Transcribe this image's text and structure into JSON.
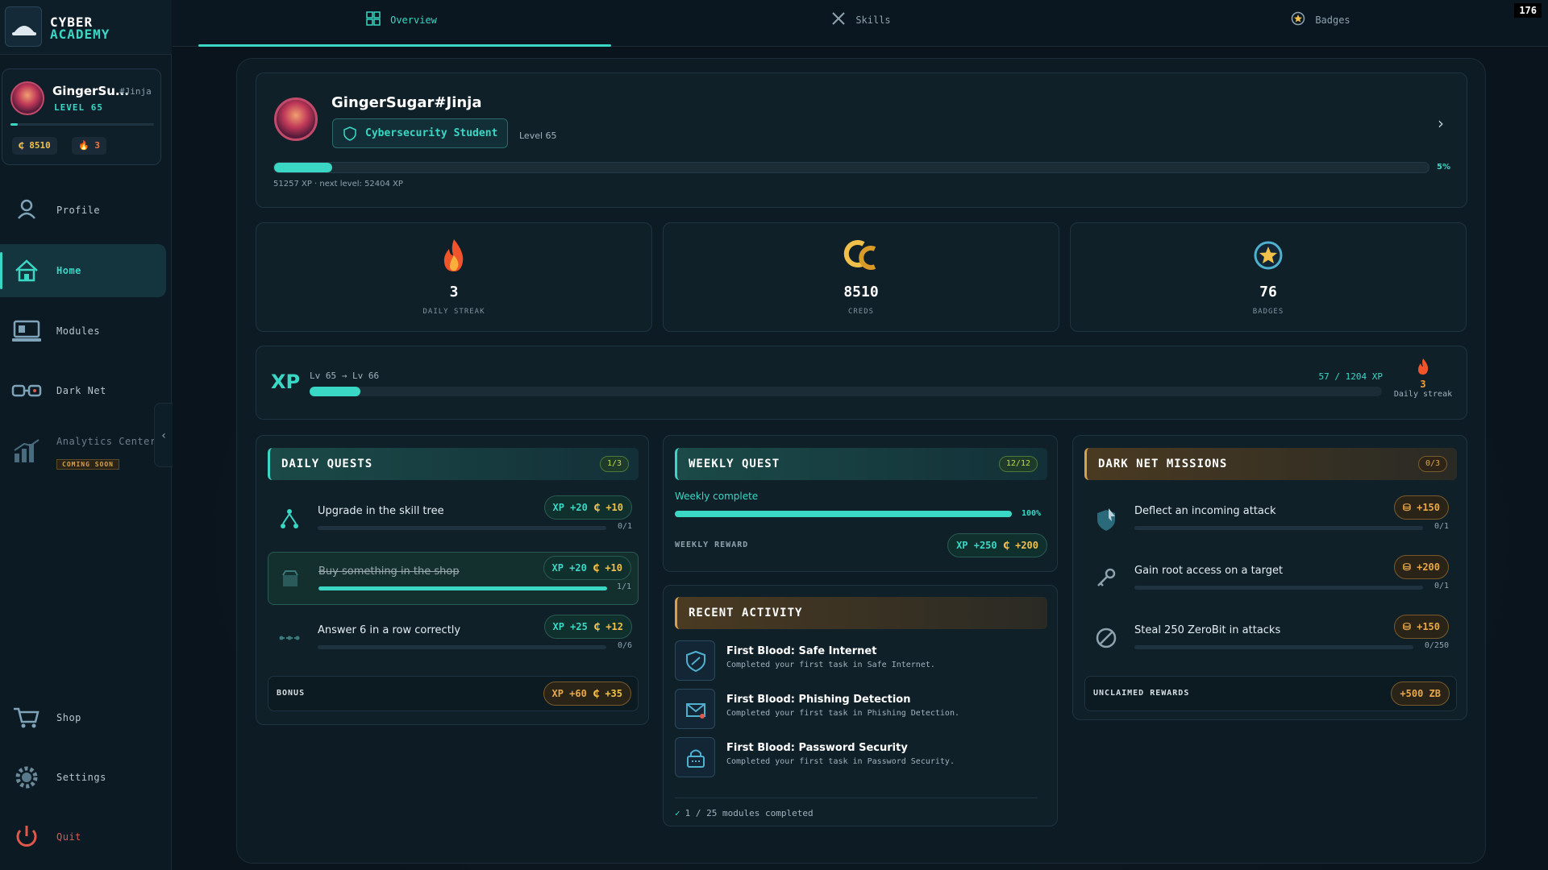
{
  "brand": {
    "line1": "CYBER",
    "line2": "ACADEMY"
  },
  "counter": "176",
  "user": {
    "name": "GingerSu...",
    "tag": "#Jinja",
    "level_label": "LEVEL 65",
    "level_progress": 0.05,
    "creds": "8510",
    "streak": "3"
  },
  "nav": {
    "profile": "Profile",
    "home": "Home",
    "modules": "Modules",
    "darknet": "Dark Net",
    "analytics": "Analytics Center",
    "coming_soon": "COMING SOON",
    "shop": "Shop",
    "settings": "Settings",
    "quit": "Quit"
  },
  "tabs": {
    "overview": "Overview",
    "skills": "Skills",
    "badges": "Badges"
  },
  "profile": {
    "name": "GingerSugar#Jinja",
    "role": "Cybersecurity Student",
    "level": "Level 65",
    "progress_pct": "5%",
    "progress": 0.05,
    "xp_text": "51257 XP · next level: 52404 XP"
  },
  "stats": {
    "streak_value": "3",
    "streak_label": "DAILY STREAK",
    "creds_value": "8510",
    "creds_label": "CREDS",
    "badges_value": "76",
    "badges_label": "BADGES"
  },
  "xp_progress": {
    "big": "XP",
    "level_range": "Lv 65 → Lv 66",
    "count": "57 / 1204 XP",
    "progress": 0.047,
    "streak_num": "3",
    "streak_label": "Daily streak"
  },
  "daily_quests": {
    "title": "DAILY QUESTS",
    "count": "1/3",
    "items": [
      {
        "title": "Upgrade in the skill tree",
        "xp": "XP +20",
        "creds": "+10",
        "progress": "0/1",
        "fill": 0
      },
      {
        "title": "Buy something in the shop",
        "xp": "XP +20",
        "creds": "+10",
        "progress": "1/1",
        "fill": 1
      },
      {
        "title": "Answer 6 in a row correctly",
        "xp": "XP +25",
        "creds": "+12",
        "progress": "0/6",
        "fill": 0
      }
    ],
    "bonus_label": "BONUS",
    "bonus_xp": "XP +60",
    "bonus_creds": "+35"
  },
  "weekly_quest": {
    "title": "WEEKLY QUEST",
    "count": "12/12",
    "status": "Weekly complete",
    "pct": "100%",
    "fill": 1,
    "reward_label": "WEEKLY REWARD",
    "reward_xp": "XP +250",
    "reward_creds": "+200"
  },
  "recent_activity": {
    "title": "RECENT ACTIVITY",
    "items": [
      {
        "title": "First Blood: Safe Internet",
        "desc": "Completed your first task in Safe Internet."
      },
      {
        "title": "First Blood: Phishing Detection",
        "desc": "Completed your first task in Phishing Detection."
      },
      {
        "title": "First Blood: Password Security",
        "desc": "Completed your first task in Password Security."
      }
    ],
    "footer": "1 / 25 modules completed"
  },
  "darknet_missions": {
    "title": "DARK NET MISSIONS",
    "count": "0/3",
    "items": [
      {
        "title": "Deflect an incoming attack",
        "reward": "+150",
        "progress": "0/1"
      },
      {
        "title": "Gain root access on a target",
        "reward": "+200",
        "progress": "0/1"
      },
      {
        "title": "Steal 250 ZeroBit in attacks",
        "reward": "+150",
        "progress": "0/250"
      }
    ],
    "unclaimed_label": "UNCLAIMED REWARDS",
    "unclaimed_value": "+500 ZB"
  },
  "colors": {
    "accent": "#3ad7c4",
    "gold": "#f0c04a",
    "danger": "#e0584a"
  }
}
